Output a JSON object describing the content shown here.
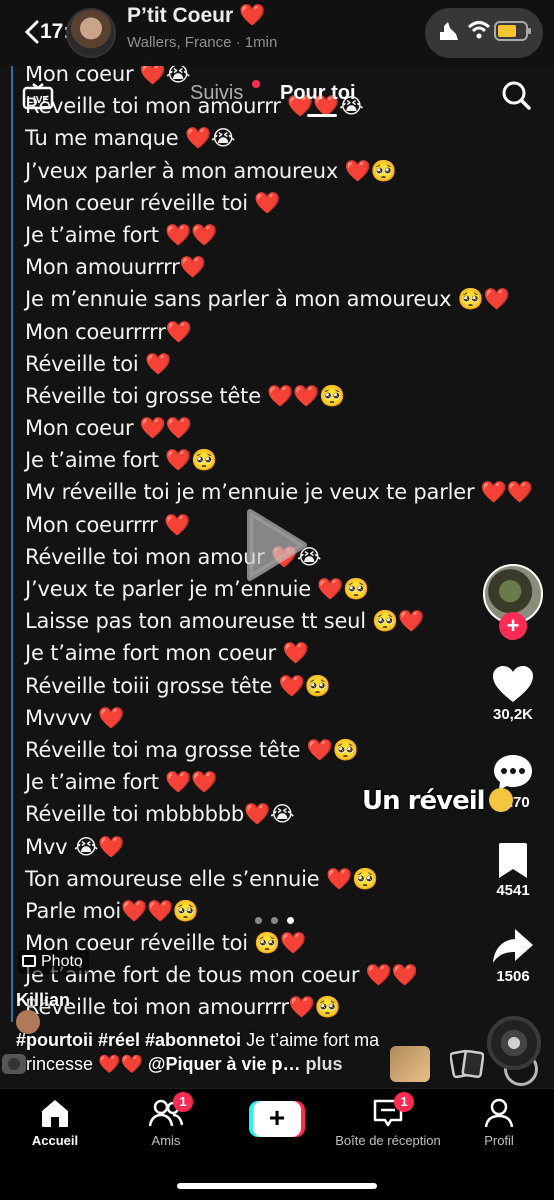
{
  "status_bar": {
    "time": "17:56"
  },
  "chat_header": {
    "name": "P’tit Coeur ❤️",
    "subtitle": "Wallers, France · 1min"
  },
  "top_nav": {
    "live_label": "LIVE",
    "tabs": [
      {
        "label": "Suivis",
        "has_dot": true
      },
      {
        "label": "Pour toi",
        "active": true
      }
    ]
  },
  "chat_messages": [
    "Mon coeur ❤️😭",
    "Réveille toi mon amourrr ❤️❤️😭",
    "Tu me manque ❤️😭",
    "J’veux parler à mon amoureux ❤️🥺",
    "Mon coeur réveille toi ❤️",
    "Je t’aime fort ❤️❤️",
    "Mon amouurrrr❤️",
    "Je m’ennuie sans parler à mon amoureux 🥺❤️",
    "Mon coeurrrrr❤️",
    "Réveille toi ❤️",
    "Réveille toi grosse tête ❤️❤️🥺",
    "Mon coeur ❤️❤️",
    "Je t’aime fort ❤️🥺",
    "Mv réveille toi je m’ennuie je veux te parler ❤️❤️",
    "Mon coeurrrr ❤️",
    "Réveille toi mon amour ❤️😭",
    "J’veux te parler je m’ennuie ❤️🥺",
    "Laisse pas ton amoureuse tt seul 🥺❤️",
    "Je t’aime fort mon coeur ❤️",
    "Réveille toiii grosse tête ❤️🥺",
    "Mvvvv ❤️",
    "Réveille toi ma grosse tête ❤️🥺",
    "Je t’aime fort ❤️❤️",
    "Réveille toi mbbbbbb❤️😭",
    "Mvv 😭❤️",
    "Ton amoureuse elle s’ennuie ❤️🥺",
    "Parle moi❤️❤️🥺",
    "Mon coeur réveille toi 🥺❤️",
    "Je t’aime fort de tous mon coeur ❤️❤️",
    "Réveille toi mon amourrrr❤️🥺"
  ],
  "sticker": {
    "text": "Un réveil"
  },
  "actions": {
    "likes": "30,2K",
    "comments": "2270",
    "saves": "4541",
    "shares": "1506"
  },
  "post": {
    "badge": "Photo",
    "creator": "Killian",
    "hashtags": "#pourtoii #réel #abonnetoi",
    "caption_text": "Je t’aime fort ma princesse",
    "caption_hearts": "❤️❤️",
    "mention": "@Piquer à vie p…",
    "more_label": "plus"
  },
  "bottom_nav": {
    "items": [
      {
        "label": "Accueil",
        "active": true
      },
      {
        "label": "Amis",
        "badge": "1"
      },
      {
        "label": "Boîte de réception",
        "badge": "1"
      },
      {
        "label": "Profil"
      }
    ]
  },
  "colors": {
    "accent_red": "#fe2c55",
    "accent_cyan": "#25f4ee",
    "chat_bar": "#2f6fa8"
  }
}
